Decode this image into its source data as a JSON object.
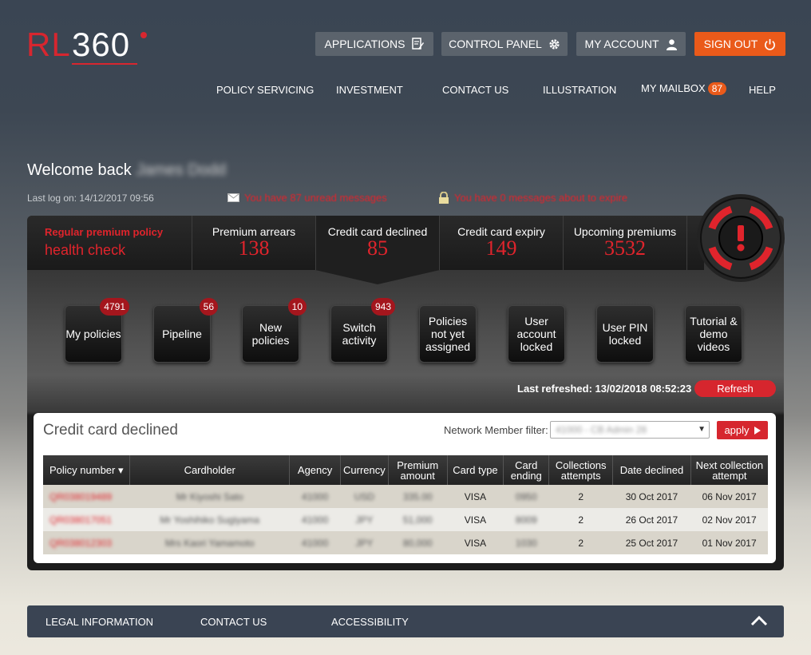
{
  "logo": {
    "rl": "RL",
    "num": "360"
  },
  "top_buttons": {
    "applications": "APPLICATIONS",
    "control_panel": "CONTROL PANEL",
    "my_account": "MY ACCOUNT",
    "sign_out": "SIGN OUT"
  },
  "nav": {
    "policy_servicing": "POLICY SERVICING",
    "investment": "INVESTMENT",
    "contact_us": "CONTACT US",
    "illustration": "ILLUSTRATION",
    "my_mailbox": "MY MAILBOX",
    "mailbox_count": "87",
    "help": "HELP"
  },
  "welcome": {
    "greeting": "Welcome back",
    "name": "James Dodd",
    "last_logon": "Last log on: 14/12/2017 09:56",
    "unread_msg": "You have 87 unread messages",
    "expire_msg": "You have 0 messages about to expire"
  },
  "health": {
    "title1": "Regular premium policy",
    "title2": "health check",
    "tabs": [
      {
        "label": "Premium arrears",
        "value": "138"
      },
      {
        "label": "Credit card declined",
        "value": "85"
      },
      {
        "label": "Credit card expiry",
        "value": "149"
      },
      {
        "label": "Upcoming premiums",
        "value": "3532"
      }
    ]
  },
  "tiles": [
    {
      "label": "My policies",
      "badge": "4791"
    },
    {
      "label": "Pipeline",
      "badge": "56"
    },
    {
      "label": "New policies",
      "badge": "10"
    },
    {
      "label": "Switch activity",
      "badge": "943"
    },
    {
      "label": "Policies not yet assigned",
      "badge": ""
    },
    {
      "label": "User account locked",
      "badge": ""
    },
    {
      "label": "User PIN locked",
      "badge": ""
    },
    {
      "label": "Tutorial & demo videos",
      "badge": ""
    }
  ],
  "refresh": {
    "last_refreshed": "Last refreshed: 13/02/2018 08:52:23",
    "button": "Refresh"
  },
  "card": {
    "title": "Credit card declined",
    "filter_label": "Network Member filter:",
    "filter_value": "41000 - CB Admin 28",
    "apply": "apply"
  },
  "table": {
    "headers": [
      "Policy number ▾",
      "Cardholder",
      "Agency",
      "Currency",
      "Premium amount",
      "Card type",
      "Card ending",
      "Collections attempts",
      "Date declined",
      "Next collection attempt"
    ],
    "rows": [
      [
        "QR038019489",
        "Mr Kiyoshi Sato",
        "41000",
        "USD",
        "335.00",
        "VISA",
        "0950",
        "2",
        "30 Oct 2017",
        "06 Nov 2017"
      ],
      [
        "QR038017051",
        "Mr Yoshihiko Sugiyama",
        "41000",
        "JPY",
        "51,000",
        "VISA",
        "8009",
        "2",
        "26 Oct 2017",
        "02 Nov 2017"
      ],
      [
        "QR038012303",
        "Mrs Kaori Yamamoto",
        "41000",
        "JPY",
        "80,000",
        "VISA",
        "1030",
        "2",
        "25 Oct 2017",
        "01 Nov 2017"
      ]
    ]
  },
  "footer": {
    "legal": "LEGAL INFORMATION",
    "contact": "CONTACT US",
    "accessibility": "ACCESSIBILITY"
  },
  "colors": {
    "brand_red": "#d7262f",
    "sign_out_orange": "#ea5a1a",
    "alert_red": "#e0242c"
  }
}
